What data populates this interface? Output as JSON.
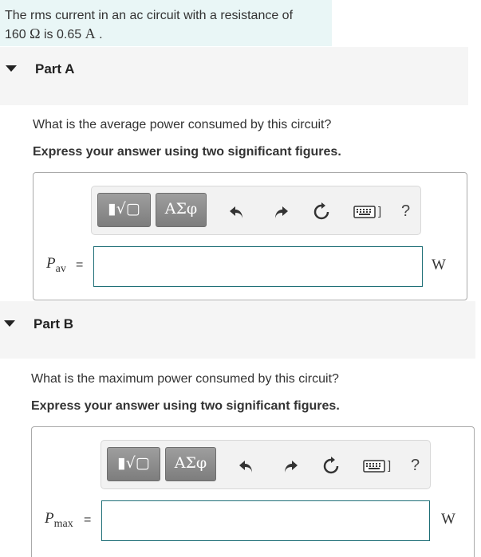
{
  "intro": {
    "line1": "The rms current in an ac circuit with a resistance of",
    "resistance_value": "160",
    "resistance_unit": "Ω",
    "text_is": "is",
    "current_value": "0.65",
    "current_unit": "A",
    "period": "."
  },
  "parts": [
    {
      "title": "Part A",
      "question": "What is the average power consumed by this circuit?",
      "instruction": "Express your answer using two significant figures.",
      "toolbar": {
        "templates_glyph": "▮√▢",
        "symbols_glyph": "ΑΣφ",
        "help": "?"
      },
      "variable": "P",
      "subscript": "av",
      "equals": "=",
      "answer_value": "",
      "unit": "W"
    },
    {
      "title": "Part B",
      "question": "What is the maximum power consumed by this circuit?",
      "instruction": "Express your answer using two significant figures.",
      "toolbar": {
        "templates_glyph": "▮√▢",
        "symbols_glyph": "ΑΣφ",
        "help": "?"
      },
      "variable": "P",
      "subscript": "max",
      "equals": "=",
      "answer_value": "",
      "unit": "W"
    }
  ],
  "colors": {
    "intro_bg": "#e9f6f6",
    "part_header_bg": "#f5f5f5",
    "toolbar_button": "#8a8a8a",
    "input_border": "#1f6f77"
  },
  "icons": [
    "caret-down-icon",
    "templates-icon",
    "symbols-icon",
    "undo-icon",
    "redo-icon",
    "reset-icon",
    "keyboard-icon",
    "help-icon"
  ]
}
